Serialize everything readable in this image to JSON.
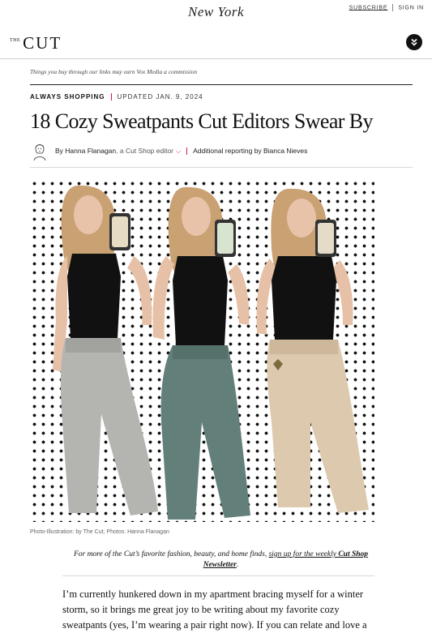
{
  "topbar": {
    "logo": "New York",
    "subscribe": "SUBSCRIBE",
    "sign_in": "SIGN IN"
  },
  "header": {
    "logo_small": "THE",
    "logo_main": "CUT",
    "menu_icon": "double-chevron-down-icon"
  },
  "disclaimer": "Things you buy through our links may earn Vox Media a commission",
  "article": {
    "rubric": "ALWAYS SHOPPING",
    "updated": "UPDATED JAN. 9, 2024",
    "headline": "18 Cozy Sweatpants Cut Editors Swear By",
    "byline_prefix": "By ",
    "author": "Hanna Flanagan",
    "author_role": ", a Cut Shop editor",
    "additional_reporting": "Additional reporting by Bianca Nieves",
    "image_caption": "Photo-Illustration: by The Cut; Photos: Hanna Flanagan",
    "newsletter_prefix": "For more of the Cut’s favorite fashion, beauty, and home finds, ",
    "newsletter_link": "sign up for the weekly ",
    "newsletter_name": "Cut Shop Newsletter",
    "newsletter_suffix": ".",
    "body": "I’m currently hunkered down in my apartment bracing myself for a winter storm, so it brings me great joy to be writing about my favorite cozy sweatpants (yes, I’m wearing a pair right now). If you can relate and love a"
  },
  "colors": {
    "accent": "#d21b3f",
    "sweatpants": [
      "#b4b4b1",
      "#627f79",
      "#ddc9ae"
    ]
  }
}
